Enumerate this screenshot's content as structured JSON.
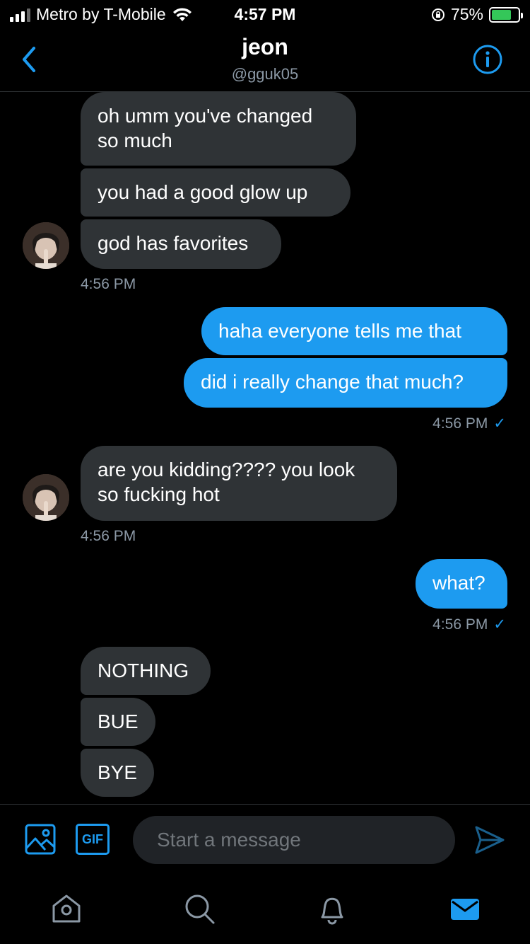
{
  "status": {
    "carrier": "Metro by T-Mobile",
    "time": "4:57 PM",
    "battery": "75%"
  },
  "header": {
    "name": "jeon",
    "handle": "@gguk05"
  },
  "messages": [
    {
      "dir": "in",
      "text_lines": [
        "oh umm you've changed",
        "so much"
      ]
    },
    {
      "dir": "in",
      "text": "you had a good glow up"
    },
    {
      "dir": "in",
      "text": "god has favorites"
    },
    {
      "stamp": "4:56 PM"
    },
    {
      "dir": "out",
      "text": "haha everyone tells me that"
    },
    {
      "dir": "out",
      "text": "did i really change that much?"
    },
    {
      "stamp": "4:56 PM",
      "read": true
    },
    {
      "dir": "in",
      "text_lines": [
        "are you kidding???? you look",
        "so fucking hot"
      ]
    },
    {
      "stamp": "4:56 PM"
    },
    {
      "dir": "out",
      "text": "what?"
    },
    {
      "stamp": "4:56 PM",
      "read": true
    },
    {
      "dir": "in",
      "text": "NOTHING"
    },
    {
      "dir": "in",
      "text": "BUE"
    },
    {
      "dir": "in",
      "text": "BYE"
    }
  ],
  "composer": {
    "placeholder": "Start a message",
    "gif_label": "GIF"
  },
  "colors": {
    "accent": "#1d9bf0",
    "incoming_bubble": "#2f3336",
    "background": "#000000"
  }
}
